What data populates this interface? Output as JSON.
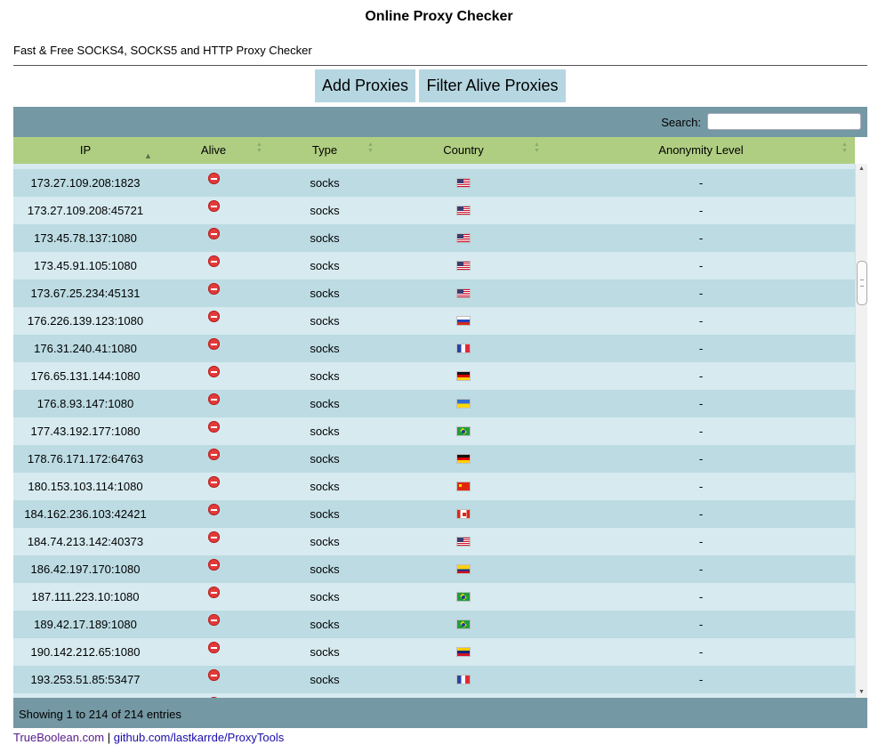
{
  "page": {
    "title": "Online Proxy Checker",
    "subtitle": "Fast & Free SOCKS4, SOCKS5 and HTTP Proxy Checker"
  },
  "buttons": {
    "add": "Add Proxies",
    "filter": "Filter Alive Proxies"
  },
  "search": {
    "label": "Search:",
    "value": ""
  },
  "table": {
    "columns": [
      "IP",
      "Alive",
      "Type",
      "Country",
      "Anonymity Level"
    ],
    "rows": [
      {
        "ip": "173.27.109.208:1823",
        "alive": "dead",
        "type": "socks",
        "country": "us",
        "anon": "-"
      },
      {
        "ip": "173.27.109.208:45721",
        "alive": "dead",
        "type": "socks",
        "country": "us",
        "anon": "-"
      },
      {
        "ip": "173.45.78.137:1080",
        "alive": "dead",
        "type": "socks",
        "country": "us",
        "anon": "-"
      },
      {
        "ip": "173.45.91.105:1080",
        "alive": "dead",
        "type": "socks",
        "country": "us",
        "anon": "-"
      },
      {
        "ip": "173.67.25.234:45131",
        "alive": "dead",
        "type": "socks",
        "country": "us",
        "anon": "-"
      },
      {
        "ip": "176.226.139.123:1080",
        "alive": "dead",
        "type": "socks",
        "country": "ru",
        "anon": "-"
      },
      {
        "ip": "176.31.240.41:1080",
        "alive": "dead",
        "type": "socks",
        "country": "fr",
        "anon": "-"
      },
      {
        "ip": "176.65.131.144:1080",
        "alive": "dead",
        "type": "socks",
        "country": "de",
        "anon": "-"
      },
      {
        "ip": "176.8.93.147:1080",
        "alive": "dead",
        "type": "socks",
        "country": "ua",
        "anon": "-"
      },
      {
        "ip": "177.43.192.177:1080",
        "alive": "dead",
        "type": "socks",
        "country": "br",
        "anon": "-"
      },
      {
        "ip": "178.76.171.172:64763",
        "alive": "dead",
        "type": "socks",
        "country": "de",
        "anon": "-"
      },
      {
        "ip": "180.153.103.114:1080",
        "alive": "dead",
        "type": "socks",
        "country": "cn",
        "anon": "-"
      },
      {
        "ip": "184.162.236.103:42421",
        "alive": "dead",
        "type": "socks",
        "country": "ca",
        "anon": "-"
      },
      {
        "ip": "184.74.213.142:40373",
        "alive": "dead",
        "type": "socks",
        "country": "us",
        "anon": "-"
      },
      {
        "ip": "186.42.197.170:1080",
        "alive": "dead",
        "type": "socks",
        "country": "co",
        "anon": "-"
      },
      {
        "ip": "187.111.223.10:1080",
        "alive": "dead",
        "type": "socks",
        "country": "br",
        "anon": "-"
      },
      {
        "ip": "189.42.17.189:1080",
        "alive": "dead",
        "type": "socks",
        "country": "br",
        "anon": "-"
      },
      {
        "ip": "190.142.212.65:1080",
        "alive": "dead",
        "type": "socks",
        "country": "ve",
        "anon": "-"
      },
      {
        "ip": "193.253.51.85:53477",
        "alive": "dead",
        "type": "socks",
        "country": "fr",
        "anon": "-"
      },
      {
        "ip": "",
        "alive": "dead",
        "type": "",
        "country": "",
        "anon": ""
      }
    ]
  },
  "info": "Showing 1 to 214 of 214 entries",
  "footer": {
    "link1": "TrueBoolean.com",
    "separator": "|",
    "link2": "github.com/lastkarrde/ProxyTools"
  },
  "colors": {
    "toolbar": "#7498a4",
    "header": "#b0ce82",
    "row_odd": "#bcdbe3",
    "row_even": "#d6eaf0",
    "button": "#b6d7e1"
  }
}
